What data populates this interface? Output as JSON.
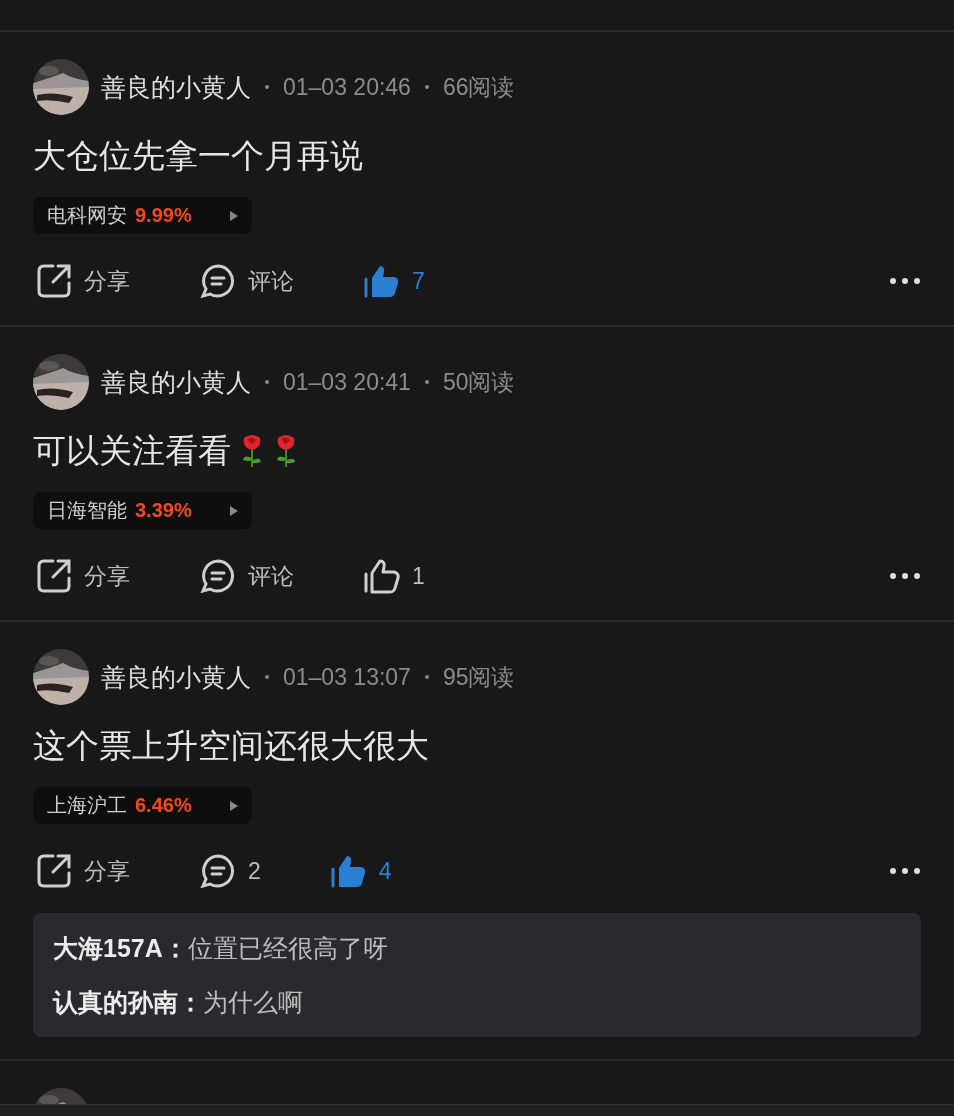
{
  "posts": [
    {
      "author": "善良的小黄人",
      "time": "01–03 20:46",
      "reads": "66阅读",
      "content": "大仓位先拿一个月再说",
      "stock": {
        "name": "电科网安",
        "change": "9.99%"
      },
      "share": "分享",
      "comment": "评论",
      "likes": "7",
      "liked": true
    },
    {
      "author": "善良的小黄人",
      "time": "01–03 20:41",
      "reads": "50阅读",
      "content": "可以关注看看",
      "emoji": [
        {
          "kind": "rose"
        },
        {
          "kind": "rose"
        }
      ],
      "stock": {
        "name": "日海智能",
        "change": "3.39%"
      },
      "share": "分享",
      "comment": "评论",
      "likes": "1",
      "liked": false
    },
    {
      "author": "善良的小黄人",
      "time": "01–03 13:07",
      "reads": "95阅读",
      "content": "这个票上升空间还很大很大",
      "stock": {
        "name": "上海沪工",
        "change": "6.46%"
      },
      "share": "分享",
      "comment": "2",
      "likes": "4",
      "liked": true,
      "comments": [
        {
          "author": "大海157A：",
          "text": "位置已经很高了呀"
        },
        {
          "author": "认真的孙南：",
          "text": "为什么啊"
        }
      ]
    }
  ]
}
